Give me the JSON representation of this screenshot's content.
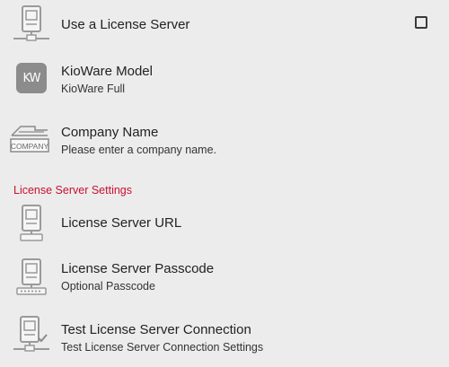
{
  "items": [
    {
      "title": "Use a License Server",
      "checkbox_checked": false
    },
    {
      "title": "KioWare Model",
      "subtitle": "KioWare Full",
      "icon_text": "KW"
    },
    {
      "title": "Company Name",
      "subtitle": "Please enter a company name.",
      "icon_text": "COMPANY"
    }
  ],
  "section": {
    "title": "License Server Settings",
    "color": "#c8102e"
  },
  "server_items": [
    {
      "title": "License Server URL"
    },
    {
      "title": "License Server Passcode",
      "subtitle": "Optional Passcode"
    },
    {
      "title": "Test License Server Connection",
      "subtitle": "Test License Server Connection Settings"
    }
  ]
}
